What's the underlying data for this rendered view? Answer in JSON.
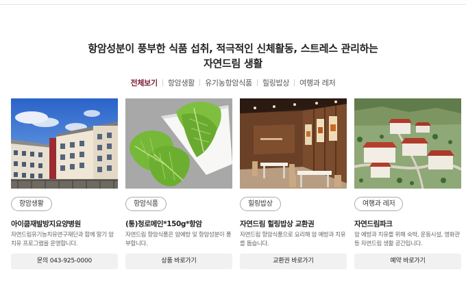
{
  "headline": {
    "line1": "항암성분이 풍부한 식품 섭취, 적극적인 신체활동, 스트레스 관리하는",
    "line2": "자연드림 생활"
  },
  "tabs": [
    {
      "label": "전체보기",
      "active": true
    },
    {
      "label": "항암생활",
      "active": false
    },
    {
      "label": "유기농항암식품",
      "active": false
    },
    {
      "label": "힐링밥상",
      "active": false
    },
    {
      "label": "여행과 레저",
      "active": false
    }
  ],
  "cards": [
    {
      "image_icon": "hospital-building-photo",
      "badge": "항암생활",
      "title": "아이쿱재발방지요양병원",
      "desc": "자연드림유기농치유연구재단과 함께 말기 암 치유 프로그램을 운영합니다.",
      "action": "문의 043-925-0000"
    },
    {
      "image_icon": "cabbage-leaves-photo",
      "badge": "항암식품",
      "title": "(통)청로메인*150g*항암",
      "desc": "자연드림 항암식품은 암예방 및 항암성분이 풍부합니다.",
      "action": "상품 바로가기"
    },
    {
      "image_icon": "restaurant-interior-photo",
      "badge": "힐링밥상",
      "title": "자연드림 힐링밥상 교환권",
      "desc": "자연드림 항암식품으로 요리해 암 예방과 치유를 돕습니다.",
      "action": "교환권 바로가기"
    },
    {
      "image_icon": "park-aerial-photo",
      "badge": "여행과 레저",
      "title": "자연드림파크",
      "desc": "암 예방과 치유를 위해 숙박, 운동시설, 영화관 등 자연드림 생활 공간입니다.",
      "action": "예약 바로가기"
    }
  ]
}
